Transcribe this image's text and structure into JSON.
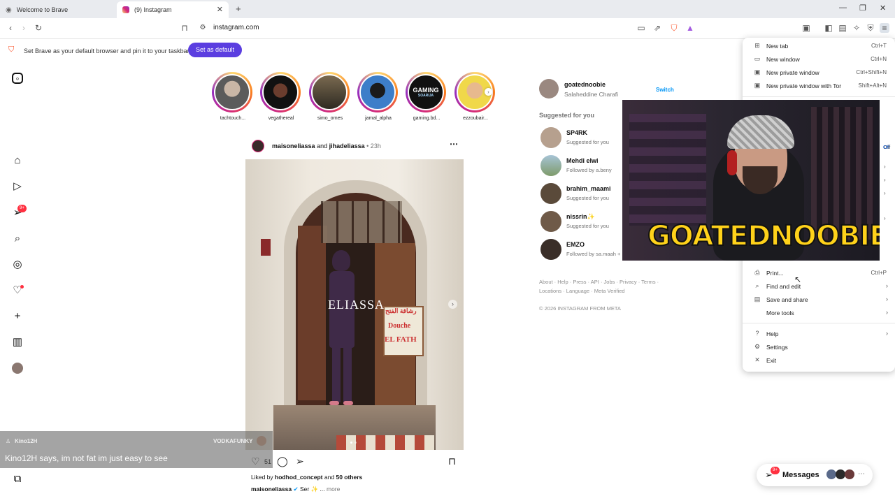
{
  "tabs": [
    {
      "label": "Welcome to Brave"
    },
    {
      "label": "(9) Instagram"
    }
  ],
  "toolbar": {
    "url": "instagram.com"
  },
  "infobar": {
    "text": "Set Brave as your default browser and pin it to your taskbar",
    "button": "Set as default"
  },
  "nav": {
    "notif_badge": "9+"
  },
  "stories": [
    {
      "name": "tachtouch..."
    },
    {
      "name": "vegathereal"
    },
    {
      "name": "simo_ornes"
    },
    {
      "name": "jamal_alpha"
    },
    {
      "name": "gaming.bd..."
    },
    {
      "name": "ezzoubair..."
    }
  ],
  "story_badge": {
    "line1": "GAMING",
    "line2": "SOARIJA"
  },
  "post": {
    "user": "maisoneliassa",
    "and": "and",
    "coauthor": "jihadeliassa",
    "time": "• 23h",
    "image_text": "ELIASSA",
    "sign_arabic": "رشاقة الفتح",
    "sign_text1": "Douche",
    "sign_text2": "EL FATH",
    "like_count": "51",
    "liked_by_prefix": "Liked by",
    "liked_by_user": "hodhod_concept",
    "liked_by_and": "and",
    "liked_by_others": "50 others",
    "caption_user": "maisoneliassa",
    "caption_text": "Ser ✨ ...",
    "caption_more": "more"
  },
  "profile": {
    "username": "goatednoobie",
    "fullname": "Salaheddine Charafi",
    "switch": "Switch"
  },
  "suggested": {
    "heading": "Suggested for you",
    "items": [
      {
        "name": "SP4RK",
        "sub": "Suggested for you"
      },
      {
        "name": "Mehdi elwi",
        "sub": "Followed by a.beny"
      },
      {
        "name": "brahim_maami",
        "sub": "Suggested for you"
      },
      {
        "name": "nissrin✨",
        "sub": "Suggested for you"
      },
      {
        "name": "EMZO",
        "sub": "Followed by sa.maah + 1 mo"
      }
    ]
  },
  "footer": {
    "line1": "About · Help · Press · API · Jobs · Privacy · Terms ·",
    "line2": "Locations · Language · Meta Verified",
    "copyright": "© 2026 INSTAGRAM FROM META"
  },
  "menu": {
    "items": [
      {
        "label": "New tab",
        "shortcut": "Ctrl+T"
      },
      {
        "label": "New window",
        "shortcut": "Ctrl+N"
      },
      {
        "label": "New private window",
        "shortcut": "Ctrl+Shift+N"
      },
      {
        "label": "New private window with Tor",
        "shortcut": "Shift+Alt+N"
      },
      {
        "label": "Print...",
        "shortcut": "Ctrl+P"
      },
      {
        "label": "Find and edit",
        "shortcut": ""
      },
      {
        "label": "Save and share",
        "shortcut": ""
      },
      {
        "label": "More tools",
        "shortcut": ""
      },
      {
        "label": "Help",
        "shortcut": ""
      },
      {
        "label": "Settings",
        "shortcut": ""
      },
      {
        "label": "Exit",
        "shortcut": ""
      }
    ],
    "off_label": "Off"
  },
  "webcam": {
    "overlay_text": "GOATEDNOOBIE"
  },
  "chat": {
    "user": "Kino12H",
    "channel": "VODKAFUNKY",
    "message": "Kino12H says, im not fat im just easy to see"
  },
  "messages": {
    "label": "Messages",
    "badge": "9+"
  }
}
